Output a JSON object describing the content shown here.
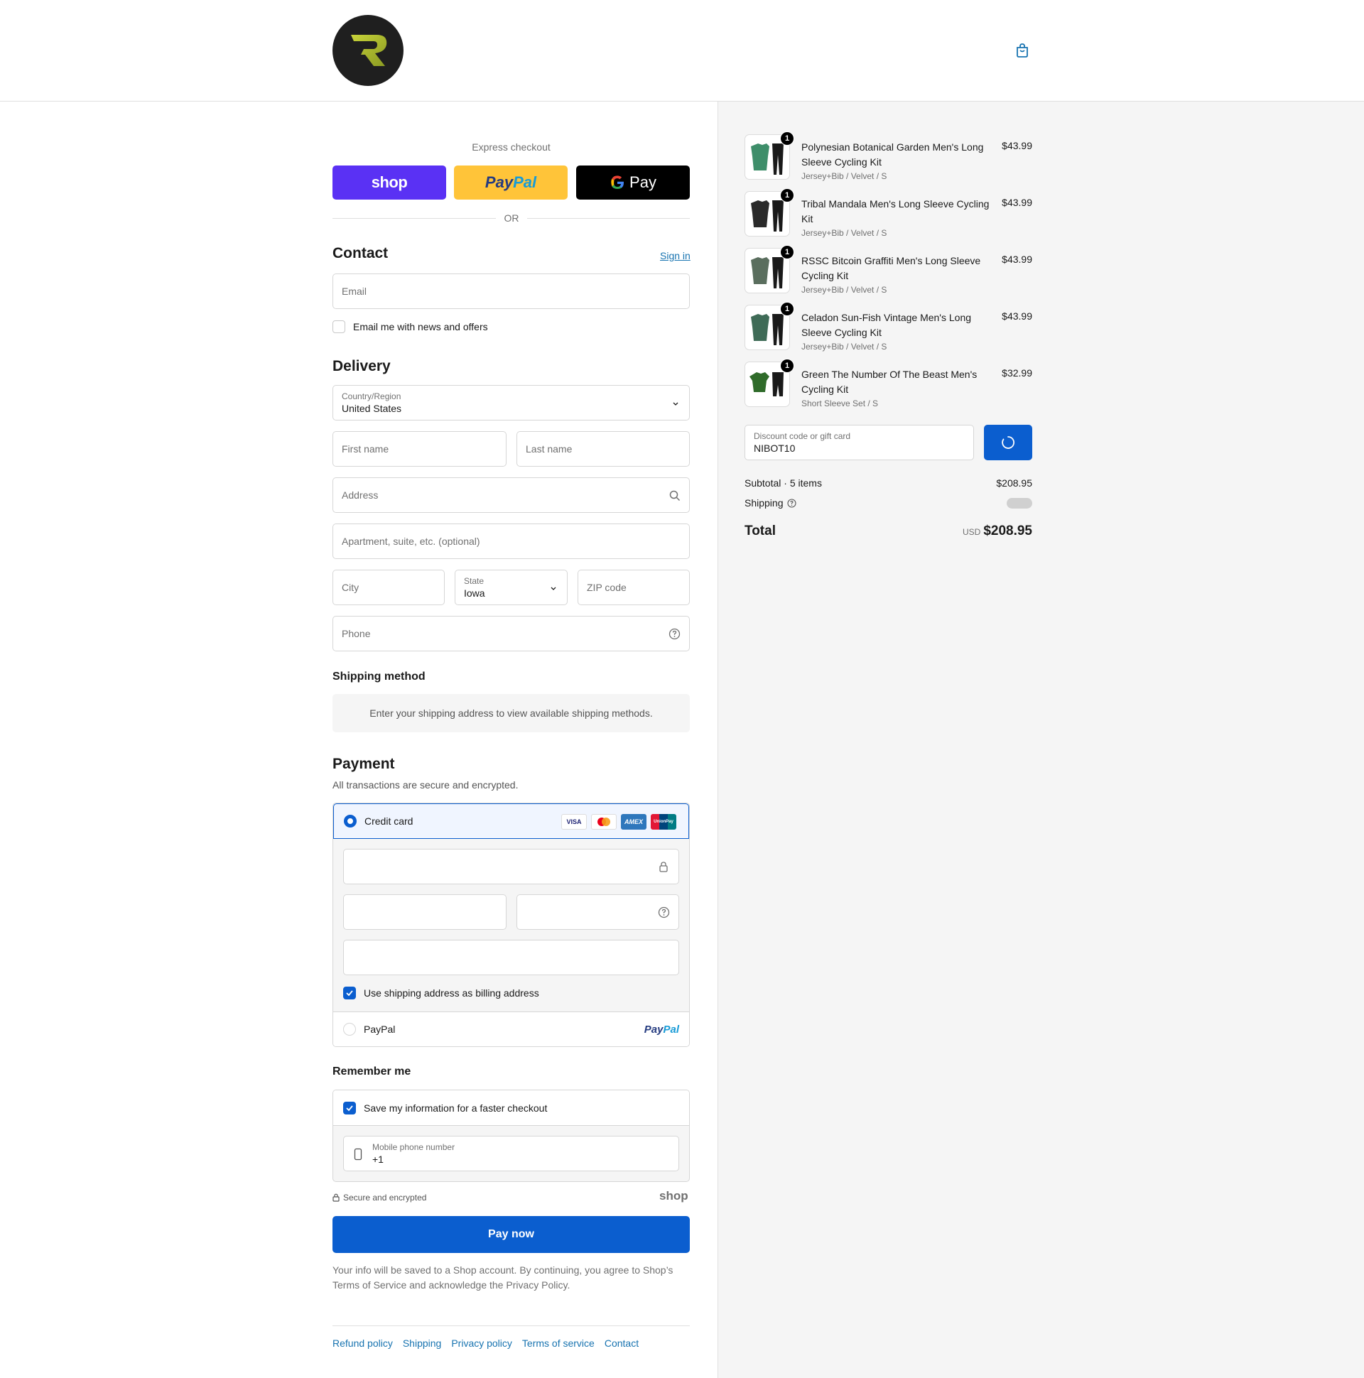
{
  "header": {
    "cart_icon": "shopping-bag-icon"
  },
  "express": {
    "title": "Express checkout",
    "shop_label": "shop",
    "paypal_label_a": "Pay",
    "paypal_label_b": "Pal",
    "gpay_label": "Pay",
    "or_label": "OR"
  },
  "contact": {
    "title": "Contact",
    "signin": "Sign in",
    "email_placeholder": "Email",
    "news_label": "Email me with news and offers"
  },
  "delivery": {
    "title": "Delivery",
    "country_label": "Country/Region",
    "country_value": "United States",
    "first_name": "First name",
    "last_name": "Last name",
    "address": "Address",
    "apartment": "Apartment, suite, etc. (optional)",
    "city": "City",
    "state_label": "State",
    "state_value": "Iowa",
    "zip": "ZIP code",
    "phone": "Phone"
  },
  "shipping_method": {
    "title": "Shipping method",
    "note": "Enter your shipping address to view available shipping methods."
  },
  "payment": {
    "title": "Payment",
    "subtitle": "All transactions are secure and encrypted.",
    "credit_card": "Credit card",
    "cards": [
      "VISA",
      "",
      "AMEX",
      "UnionPay"
    ],
    "billing_label": "Use shipping address as billing address",
    "paypal": "PayPal",
    "paypal_logo_a": "Pay",
    "paypal_logo_b": "Pal"
  },
  "remember": {
    "title": "Remember me",
    "save_label": "Save my information for a faster checkout",
    "mobile_label": "Mobile phone number",
    "mobile_value": "+1",
    "secure": "Secure and encrypted",
    "shop_logo": "shop"
  },
  "pay_now": "Pay now",
  "fine_print": {
    "text_a": "Your info will be saved to a Shop account. By continuing, you agree to Shop’s",
    "terms": "Terms of Service",
    "text_b": "and acknowledge the",
    "privacy": "Privacy Policy",
    "text_c": "."
  },
  "footer": [
    "Refund policy",
    "Shipping",
    "Privacy policy",
    "Terms of service",
    "Contact"
  ],
  "order": {
    "items": [
      {
        "qty": "1",
        "name": "Polynesian Botanical Garden Men's Long Sleeve Cycling Kit",
        "variant": "Jersey+Bib / Velvet / S",
        "price": "$43.99",
        "color": "#3e8e6a"
      },
      {
        "qty": "1",
        "name": "Tribal Mandala Men's Long Sleeve Cycling Kit",
        "variant": "Jersey+Bib / Velvet / S",
        "price": "$43.99",
        "color": "#2a2a2a"
      },
      {
        "qty": "1",
        "name": "RSSC Bitcoin Graffiti Men's Long Sleeve Cycling Kit",
        "variant": "Jersey+Bib / Velvet / S",
        "price": "$43.99",
        "color": "#5a6e5e"
      },
      {
        "qty": "1",
        "name": "Celadon Sun-Fish Vintage Men's Long Sleeve Cycling Kit",
        "variant": "Jersey+Bib / Velvet / S",
        "price": "$43.99",
        "color": "#3f6b57"
      },
      {
        "qty": "1",
        "name": "Green The Number Of The Beast Men's Cycling Kit",
        "variant": "Short Sleeve Set / S",
        "price": "$32.99",
        "color": "#2f6b2a"
      }
    ],
    "discount_label": "Discount code or gift card",
    "discount_value": "NIBOT10",
    "subtotal_label": "Subtotal · 5 items",
    "subtotal_value": "$208.95",
    "shipping_label": "Shipping",
    "total_label": "Total",
    "currency": "USD",
    "total_value": "$208.95"
  }
}
